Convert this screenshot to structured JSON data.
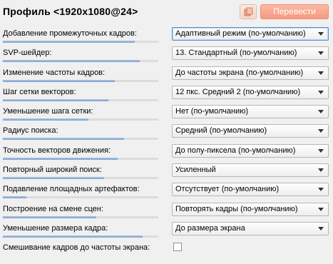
{
  "header": {
    "title": "Профиль <1920x1080@24>",
    "translate_label": "Перевести"
  },
  "settings": [
    {
      "label": "Добавление промежуточных кадров:",
      "value": "Адаптивный режим (по-умолчанию)",
      "bar": 0.85,
      "focused": true
    },
    {
      "label": "SVP-шейдер:",
      "value": "13. Стандартный (по-умолчанию)",
      "bar": 0.88
    },
    {
      "label": "Изменение частоты кадров:",
      "value": "До частоты экрана (по-умолчанию)",
      "bar": 0.72
    },
    {
      "label": "Шаг сетки векторов:",
      "value": "12 пкс. Средний 2 (по-умолчанию)",
      "bar": 0.68
    },
    {
      "label": "Уменьшение шага сетки:",
      "value": "Нет (по-умолчанию)",
      "bar": 0.55
    },
    {
      "label": "Радиус поиска:",
      "value": "Средний (по-умолчанию)",
      "bar": 0.78
    },
    {
      "label": "Точность векторов движения:",
      "value": "До полу-пиксела (по-умолчанию)",
      "bar": 0.74
    },
    {
      "label": "Повторный широкий поиск:",
      "value": "Усиленный",
      "bar": 0.65
    },
    {
      "label": "Подавление площадных артефактов:",
      "value": "Отсутствует (по-умолчанию)",
      "bar": 0.15
    },
    {
      "label": "Построение на смене сцен:",
      "value": "Повторять кадры (по-умолчанию)",
      "bar": 0.6
    },
    {
      "label": "Уменьшение размера кадра:",
      "value": "До размера экрана",
      "bar": 0.9
    }
  ],
  "blend": {
    "label": "Смешивание кадров до частоты экрана:",
    "checked": false
  }
}
